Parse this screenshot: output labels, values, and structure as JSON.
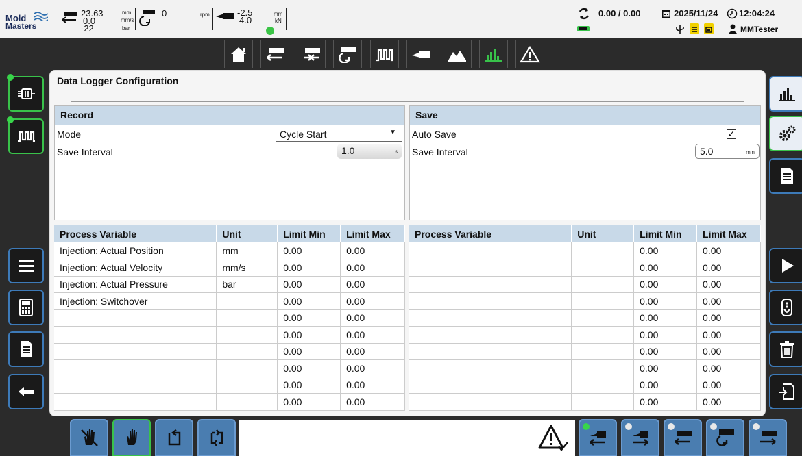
{
  "logo": {
    "line1": "Mold",
    "line2": "Masters"
  },
  "indicators": {
    "inj_position": "23.63",
    "inj_velocity": "0.0",
    "inj_pressure": "-22",
    "unit_position": "mm",
    "unit_velocity": "mm/s",
    "unit_pressure": "bar",
    "screw_rpm": "0",
    "unit_rpm": "rpm",
    "clamp_position": "-2.5",
    "clamp_force": "4.0",
    "unit_clamp_pos": "mm",
    "unit_clamp_force": "kN"
  },
  "status": {
    "cycle_times": "0.00 / 0.00",
    "date": "2025/11/24",
    "time": "12:04:24",
    "user": "MMTester"
  },
  "page": {
    "title": "Data Logger Configuration"
  },
  "record": {
    "header": "Record",
    "mode_label": "Mode",
    "mode_value": "Cycle Start",
    "interval_label": "Save Interval",
    "interval_value": "1.0",
    "interval_unit": "s"
  },
  "save": {
    "header": "Save",
    "auto_save_label": "Auto Save",
    "auto_save_checked": true,
    "interval_label": "Save Interval",
    "interval_value": "5.0",
    "interval_unit": "min"
  },
  "table_left": {
    "headers": [
      "Process Variable",
      "Unit",
      "Limit Min",
      "Limit Max"
    ],
    "rows": [
      [
        "Injection: Actual Position",
        "mm",
        "0.00",
        "0.00"
      ],
      [
        "Injection: Actual Velocity",
        "mm/s",
        "0.00",
        "0.00"
      ],
      [
        "Injection: Actual Pressure",
        "bar",
        "0.00",
        "0.00"
      ],
      [
        "Injection: Switchover",
        "",
        "0.00",
        "0.00"
      ],
      [
        "",
        "",
        "0.00",
        "0.00"
      ],
      [
        "",
        "",
        "0.00",
        "0.00"
      ],
      [
        "",
        "",
        "0.00",
        "0.00"
      ],
      [
        "",
        "",
        "0.00",
        "0.00"
      ],
      [
        "",
        "",
        "0.00",
        "0.00"
      ],
      [
        "",
        "",
        "0.00",
        "0.00"
      ]
    ]
  },
  "table_right": {
    "headers": [
      "Process Variable",
      "Unit",
      "Limit Min",
      "Limit Max"
    ],
    "rows": [
      [
        "",
        "",
        "0.00",
        "0.00"
      ],
      [
        "",
        "",
        "0.00",
        "0.00"
      ],
      [
        "",
        "",
        "0.00",
        "0.00"
      ],
      [
        "",
        "",
        "0.00",
        "0.00"
      ],
      [
        "",
        "",
        "0.00",
        "0.00"
      ],
      [
        "",
        "",
        "0.00",
        "0.00"
      ],
      [
        "",
        "",
        "0.00",
        "0.00"
      ],
      [
        "",
        "",
        "0.00",
        "0.00"
      ],
      [
        "",
        "",
        "0.00",
        "0.00"
      ],
      [
        "",
        "",
        "0.00",
        "0.00"
      ]
    ]
  },
  "colors": {
    "accent": "#3d7ab8",
    "active": "#39c24a",
    "header": "#c8d9e8"
  },
  "icons": {
    "topnav": [
      "home-icon",
      "injection-icon",
      "hold-icon",
      "plasticize-icon",
      "heaters-icon",
      "clamp-icon",
      "mold-icon",
      "datalogger-icon",
      "alarm-icon"
    ],
    "left": [
      "ejector-icon",
      "heaters-icon",
      "menu-icon",
      "calculator-icon",
      "document-icon",
      "back-icon"
    ],
    "right": [
      "chart-icon",
      "settings-icon",
      "document-icon",
      "play-icon",
      "more-icon",
      "trash-icon",
      "export-icon"
    ],
    "bottom_left": [
      "manual-off-icon",
      "manual-icon",
      "semi-auto-icon",
      "auto-icon"
    ],
    "bottom_right": [
      "warning-check-icon",
      "carriage-back-icon",
      "carriage-forward-icon",
      "injection-back-icon",
      "decompress-icon",
      "injection-forward-icon"
    ]
  }
}
